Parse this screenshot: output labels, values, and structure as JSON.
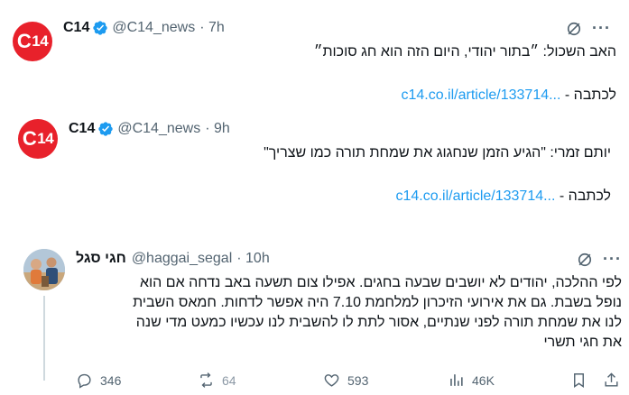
{
  "tweet1": {
    "name": "C14",
    "handle": "@C14_news",
    "time": "· 7h",
    "text": "האב השכול: ״בתור יהודי, היום הזה הוא חג סוכות״",
    "link_prefix": "לכתבה - ",
    "link": "c14.co.il/article/133714..."
  },
  "tweet2": {
    "name": "C14",
    "handle": "@C14_news",
    "time": "· 9h",
    "text": "יותם זמרי: \"הגיע הזמן שנחגוג את שמחת תורה כמו שצריך\"",
    "link_prefix": "לכתבה - ",
    "link": "c14.co.il/article/133714..."
  },
  "tweet3": {
    "name": "חגי סגל",
    "handle": "@haggai_segal",
    "time": "· 10h",
    "lines": [
      "לפי ההלכה, יהודים לא יושבים שבעה בחגים. אפילו צום תשעה באב נדחה אם הוא",
      "נופל בשבת. גם את אירועי הזיכרון למלחמת 7.10 היה אפשר לדחות. חמאס השבית",
      "לנו את שמחת תורה לפני שנתיים, אסור לתת לו להשבית לנו עכשיו כמעט מדי שנה",
      "את חגי תשרי"
    ],
    "actions": {
      "replies": "346",
      "reposts": "64",
      "likes": "593",
      "views": "46K"
    }
  },
  "avatar_logo": {
    "text_c": "C",
    "text_num": "14"
  },
  "colors": {
    "brand_red": "#e8212b",
    "link_blue": "#1d9bf0",
    "secondary": "#536471",
    "verified": "#1d9bf0"
  },
  "icons": [
    "grok-icon",
    "more-icon",
    "verified-icon",
    "reply-icon",
    "repost-icon",
    "like-icon",
    "views-icon",
    "bookmark-icon",
    "share-icon"
  ]
}
